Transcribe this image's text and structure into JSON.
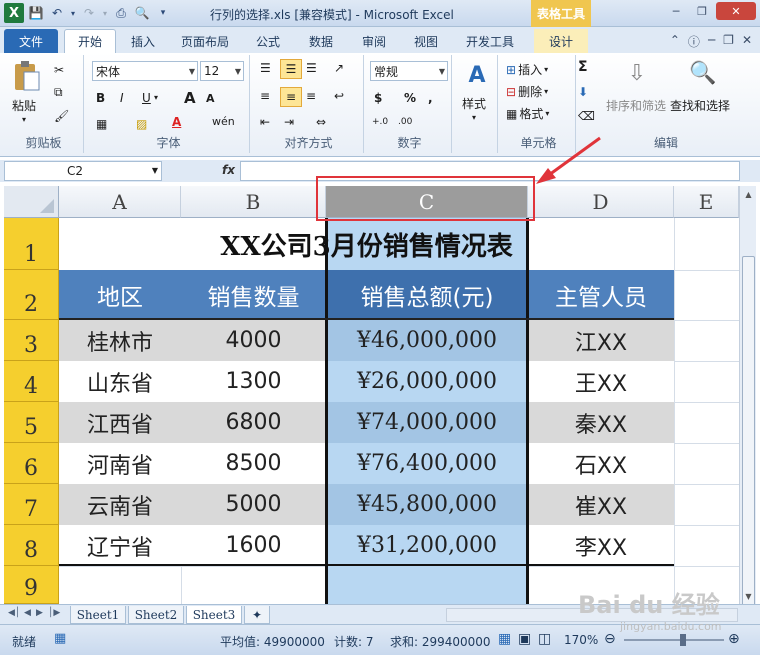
{
  "window": {
    "title": "行列的选择.xls  [兼容模式] - Microsoft Excel",
    "context_tab_group": "表格工具"
  },
  "tabs": [
    "文件",
    "开始",
    "插入",
    "页面布局",
    "公式",
    "数据",
    "审阅",
    "视图",
    "开发工具",
    "设计"
  ],
  "active_tab": "开始",
  "ribbon": {
    "clipboard": {
      "paste": "粘贴",
      "label": "剪贴板"
    },
    "font": {
      "name": "宋体",
      "size": "12",
      "label": "字体",
      "bold": "B",
      "italic": "I",
      "underline": "U",
      "grow": "A",
      "shrink": "A",
      "wen": "wén"
    },
    "alignment": {
      "label": "对齐方式"
    },
    "number": {
      "format": "常规",
      "label": "数字",
      "currency": "$",
      "percent": "%",
      "comma": ",",
      "inc": "+.0",
      "dec": ".00"
    },
    "styles": {
      "label": "样式"
    },
    "cells": {
      "insert": "插入",
      "delete": "删除",
      "format": "格式",
      "label": "单元格"
    },
    "editing": {
      "sort": "排序和筛选",
      "find": "查找和选择",
      "label": "编辑",
      "sum": "Σ"
    }
  },
  "formula_bar": {
    "name_box": "C2",
    "fx": "fx",
    "content": ""
  },
  "grid": {
    "columns": [
      "A",
      "B",
      "C",
      "D",
      "E"
    ],
    "selected_column": "C",
    "rows": [
      "1",
      "2",
      "3",
      "4",
      "5",
      "6",
      "7",
      "8",
      "9"
    ],
    "title": "XX公司3月份销售情况表",
    "headers": [
      "地区",
      "销售数量",
      "销售总额(元)",
      "主管人员"
    ],
    "data": [
      [
        "桂林市",
        "4000",
        "¥46,000,000",
        "江XX"
      ],
      [
        "山东省",
        "1300",
        "¥26,000,000",
        "王XX"
      ],
      [
        "江西省",
        "6800",
        "¥74,000,000",
        "秦XX"
      ],
      [
        "河南省",
        "8500",
        "¥76,400,000",
        "石XX"
      ],
      [
        "云南省",
        "5000",
        "¥45,800,000",
        "崔XX"
      ],
      [
        "辽宁省",
        "1600",
        "¥31,200,000",
        "李XX"
      ]
    ]
  },
  "sheets": [
    "Sheet1",
    "Sheet2",
    "Sheet3"
  ],
  "active_sheet": "Sheet3",
  "status": {
    "mode": "就绪",
    "average": "平均值: 49900000",
    "count": "计数: 7",
    "sum": "求和: 299400000",
    "zoom": "170%"
  },
  "watermark": {
    "main": "Bai du 经验",
    "sub": "jingyan.baidu.com"
  },
  "colors": {
    "header_fill": "#4f81bd",
    "row_header": "#f5cf2e",
    "selection": "#b8d7f2",
    "stripe": "#d9d9d9",
    "annotation": "#e0343a"
  }
}
